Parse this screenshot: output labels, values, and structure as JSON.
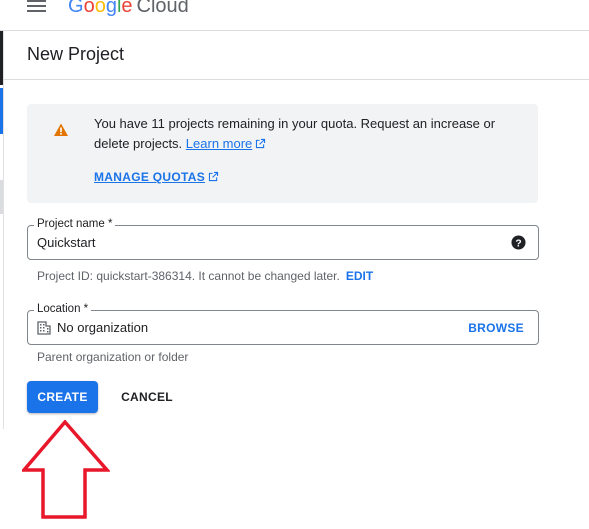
{
  "header": {
    "logo_google": "Google",
    "logo_cloud": "Cloud"
  },
  "page": {
    "title": "New Project"
  },
  "quota": {
    "message": "You have 11 projects remaining in your quota. Request an increase or delete projects.",
    "learn_more": "Learn more",
    "manage_quotas": "MANAGE QUOTAS"
  },
  "project_name": {
    "label": "Project name *",
    "value": "Quickstart",
    "hint": "Project ID: quickstart-386314. It cannot be changed later.",
    "edit_label": "EDIT"
  },
  "location": {
    "label": "Location *",
    "value": "No organization",
    "browse_label": "BROWSE",
    "hint": "Parent organization or folder"
  },
  "actions": {
    "create_label": "CREATE",
    "cancel_label": "CANCEL"
  },
  "colors": {
    "accent": "#1a73e8",
    "warning": "#e37400",
    "arrow": "#e8172a"
  }
}
